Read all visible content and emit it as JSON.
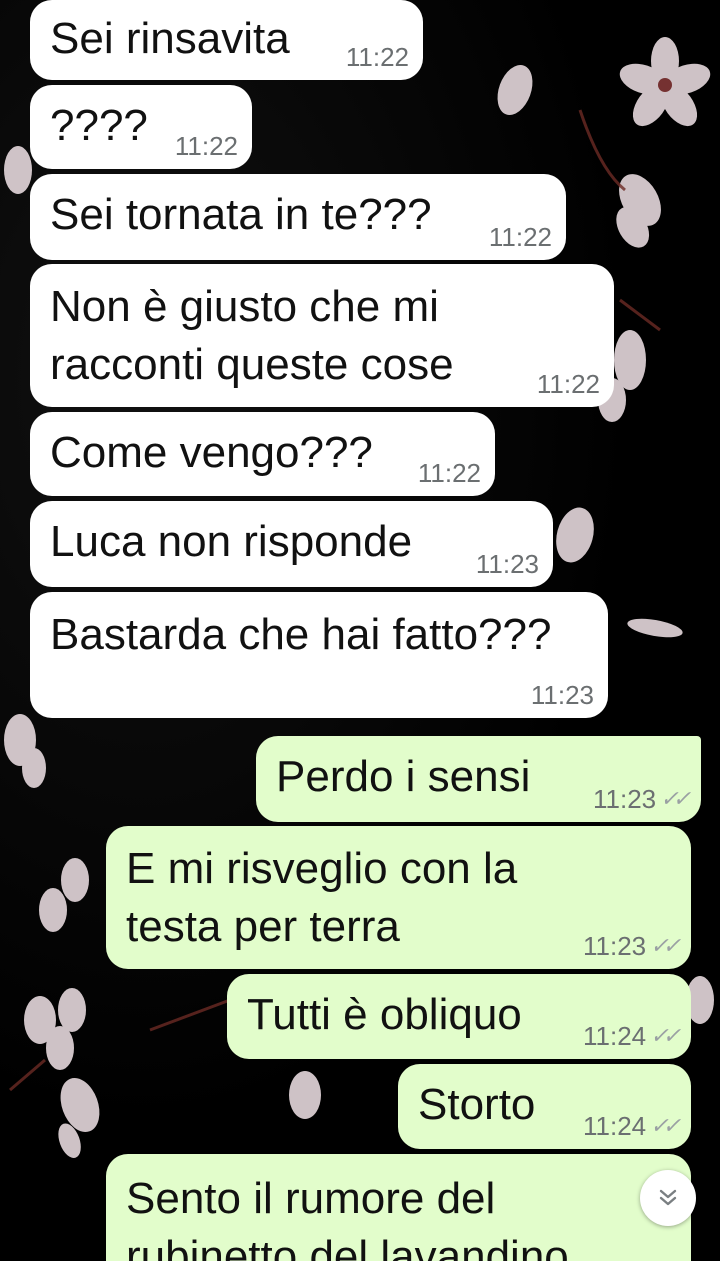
{
  "conversation": {
    "messages": [
      {
        "direction": "incoming",
        "text": "Sei rinsavita",
        "time": "11:22"
      },
      {
        "direction": "incoming",
        "text": "????",
        "time": "11:22"
      },
      {
        "direction": "incoming",
        "text": "Sei tornata in te???",
        "time": "11:22"
      },
      {
        "direction": "incoming",
        "text": "Non è giusto che mi\nracconti queste cose",
        "time": "11:22"
      },
      {
        "direction": "incoming",
        "text": "Come vengo???",
        "time": "11:22"
      },
      {
        "direction": "incoming",
        "text": "Luca non risponde",
        "time": "11:23"
      },
      {
        "direction": "incoming",
        "text": "Bastarda che hai fatto???",
        "time": "11:23"
      },
      {
        "direction": "outgoing",
        "text": "Perdo i sensi",
        "time": "11:23",
        "status": "read-double-check"
      },
      {
        "direction": "outgoing",
        "text": "E mi risveglio con la\ntesta per terra",
        "time": "11:23",
        "status": "read-double-check"
      },
      {
        "direction": "outgoing",
        "text": "Tutti è obliquo",
        "time": "11:24",
        "status": "read-double-check"
      },
      {
        "direction": "outgoing",
        "text": "Storto",
        "time": "11:24",
        "status": "read-double-check"
      },
      {
        "direction": "outgoing",
        "text": "Sento il rumore del\nrubinetto del lavandino",
        "time": "",
        "status": ""
      }
    ]
  },
  "controls": {
    "scroll_down_icon": "double-chevron-down-icon"
  },
  "colors": {
    "incoming_bubble": "#ffffff",
    "outgoing_bubble": "#e2fdcb",
    "background": "#000000",
    "timestamp": "#6b6f71"
  }
}
